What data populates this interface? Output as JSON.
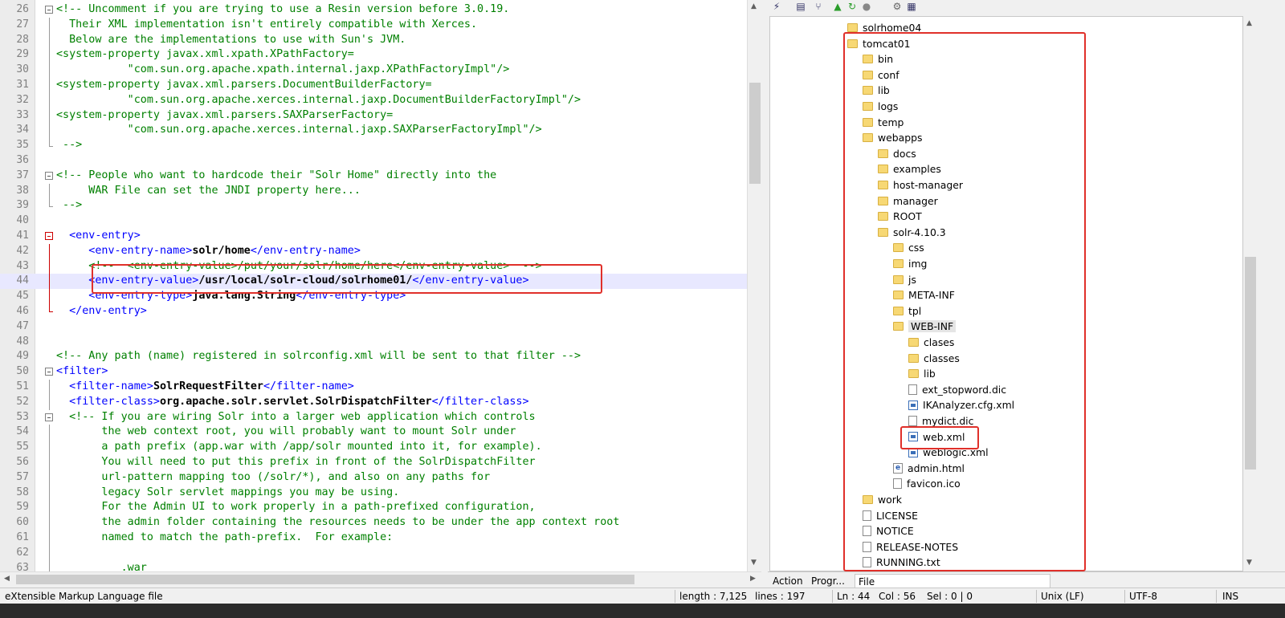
{
  "editor": {
    "lines": [
      {
        "n": "26",
        "fold": "box",
        "tok": [
          {
            "c": "com",
            "t": "<!-- Uncomment if you are trying to use a Resin version before 3.0.19."
          }
        ]
      },
      {
        "n": "27",
        "fold": "bar",
        "tok": [
          {
            "c": "com",
            "t": "  Their XML implementation isn't entirely compatible with Xerces."
          }
        ]
      },
      {
        "n": "28",
        "fold": "bar",
        "tok": [
          {
            "c": "com",
            "t": "  Below are the implementations to use with Sun's JVM."
          }
        ]
      },
      {
        "n": "29",
        "fold": "bar",
        "tok": [
          {
            "c": "com",
            "t": "<system-property javax.xml.xpath.XPathFactory="
          }
        ]
      },
      {
        "n": "30",
        "fold": "bar",
        "tok": [
          {
            "c": "com",
            "t": "           \"com.sun.org.apache.xpath.internal.jaxp.XPathFactoryImpl\"/>"
          }
        ]
      },
      {
        "n": "31",
        "fold": "bar",
        "tok": [
          {
            "c": "com",
            "t": "<system-property javax.xml.parsers.DocumentBuilderFactory="
          }
        ]
      },
      {
        "n": "32",
        "fold": "bar",
        "tok": [
          {
            "c": "com",
            "t": "           \"com.sun.org.apache.xerces.internal.jaxp.DocumentBuilderFactoryImpl\"/>"
          }
        ]
      },
      {
        "n": "33",
        "fold": "bar",
        "tok": [
          {
            "c": "com",
            "t": "<system-property javax.xml.parsers.SAXParserFactory="
          }
        ]
      },
      {
        "n": "34",
        "fold": "bar",
        "tok": [
          {
            "c": "com",
            "t": "           \"com.sun.org.apache.xerces.internal.jaxp.SAXParserFactoryImpl\"/>"
          }
        ]
      },
      {
        "n": "35",
        "fold": "end",
        "tok": [
          {
            "c": "com",
            "t": " -->"
          }
        ]
      },
      {
        "n": "36",
        "fold": "",
        "tok": []
      },
      {
        "n": "37",
        "fold": "box",
        "tok": [
          {
            "c": "com",
            "t": "<!-- People who want to hardcode their \"Solr Home\" directly into the"
          }
        ]
      },
      {
        "n": "38",
        "fold": "bar",
        "tok": [
          {
            "c": "com",
            "t": "     WAR File can set the JNDI property here..."
          }
        ]
      },
      {
        "n": "39",
        "fold": "end",
        "tok": [
          {
            "c": "com",
            "t": " -->"
          }
        ]
      },
      {
        "n": "40",
        "fold": "",
        "tok": []
      },
      {
        "n": "41",
        "fold": "redbox",
        "tok": [
          {
            "c": "tag",
            "t": "  <env-entry>"
          }
        ]
      },
      {
        "n": "42",
        "fold": "redbar",
        "tok": [
          {
            "c": "tag",
            "t": "     <env-entry-name>"
          },
          {
            "c": "txt",
            "t": "solr/home"
          },
          {
            "c": "tag",
            "t": "</env-entry-name>"
          }
        ]
      },
      {
        "n": "43",
        "fold": "redbar",
        "tok": [
          {
            "c": "com",
            "t": "     <!--  <env-entry-value>/put/your/solr/home/here</env-entry-value>  -->"
          }
        ]
      },
      {
        "n": "44",
        "fold": "redbar",
        "cur": true,
        "tok": [
          {
            "c": "tag",
            "t": "     <env-entry-value>"
          },
          {
            "c": "txt",
            "t": "/usr/local/solr-cloud/solrhome01/"
          },
          {
            "c": "tag",
            "t": "</env-entry-value>"
          }
        ]
      },
      {
        "n": "45",
        "fold": "redbar",
        "tok": [
          {
            "c": "tag",
            "t": "     <env-entry-type>"
          },
          {
            "c": "txt",
            "t": "java.lang.String"
          },
          {
            "c": "tag",
            "t": "</env-entry-type>"
          }
        ]
      },
      {
        "n": "46",
        "fold": "redend",
        "tok": [
          {
            "c": "tag",
            "t": "  </env-entry>"
          }
        ]
      },
      {
        "n": "47",
        "fold": "",
        "tok": []
      },
      {
        "n": "48",
        "fold": "",
        "tok": []
      },
      {
        "n": "49",
        "fold": "",
        "tok": [
          {
            "c": "com",
            "t": "<!-- Any path (name) registered in solrconfig.xml will be sent to that filter -->"
          }
        ]
      },
      {
        "n": "50",
        "fold": "box",
        "tok": [
          {
            "c": "tag",
            "t": "<filter>"
          }
        ]
      },
      {
        "n": "51",
        "fold": "bar",
        "tok": [
          {
            "c": "tag",
            "t": "  <filter-name>"
          },
          {
            "c": "txt",
            "t": "SolrRequestFilter"
          },
          {
            "c": "tag",
            "t": "</filter-name>"
          }
        ]
      },
      {
        "n": "52",
        "fold": "bar",
        "tok": [
          {
            "c": "tag",
            "t": "  <filter-class>"
          },
          {
            "c": "txt",
            "t": "org.apache.solr.servlet.SolrDispatchFilter"
          },
          {
            "c": "tag",
            "t": "</filter-class>"
          }
        ]
      },
      {
        "n": "53",
        "fold": "box",
        "tok": [
          {
            "c": "com",
            "t": "  <!-- If you are wiring Solr into a larger web application which controls"
          }
        ]
      },
      {
        "n": "54",
        "fold": "bar",
        "tok": [
          {
            "c": "com",
            "t": "       the web context root, you will probably want to mount Solr under"
          }
        ]
      },
      {
        "n": "55",
        "fold": "bar",
        "tok": [
          {
            "c": "com",
            "t": "       a path prefix (app.war with /app/solr mounted into it, for example)."
          }
        ]
      },
      {
        "n": "56",
        "fold": "bar",
        "tok": [
          {
            "c": "com",
            "t": "       You will need to put this prefix in front of the SolrDispatchFilter"
          }
        ]
      },
      {
        "n": "57",
        "fold": "bar",
        "tok": [
          {
            "c": "com",
            "t": "       url-pattern mapping too (/solr/*), and also on any paths for"
          }
        ]
      },
      {
        "n": "58",
        "fold": "bar",
        "tok": [
          {
            "c": "com",
            "t": "       legacy Solr servlet mappings you may be using."
          }
        ]
      },
      {
        "n": "59",
        "fold": "bar",
        "tok": [
          {
            "c": "com",
            "t": "       For the Admin UI to work properly in a path-prefixed configuration,"
          }
        ]
      },
      {
        "n": "60",
        "fold": "bar",
        "tok": [
          {
            "c": "com",
            "t": "       the admin folder containing the resources needs to be under the app context root"
          }
        ]
      },
      {
        "n": "61",
        "fold": "bar",
        "tok": [
          {
            "c": "com",
            "t": "       named to match the path-prefix.  For example:"
          }
        ]
      },
      {
        "n": "62",
        "fold": "bar",
        "tok": []
      },
      {
        "n": "63",
        "fold": "bar",
        "tok": [
          {
            "c": "com",
            "t": "          .war"
          }
        ]
      }
    ]
  },
  "tree": {
    "items": [
      {
        "label": "solrhome04",
        "type": "folder",
        "depth": 0
      },
      {
        "label": "tomcat01",
        "type": "folder",
        "depth": 0
      },
      {
        "label": "bin",
        "type": "folder",
        "depth": 1
      },
      {
        "label": "conf",
        "type": "folder",
        "depth": 1
      },
      {
        "label": "lib",
        "type": "folder",
        "depth": 1
      },
      {
        "label": "logs",
        "type": "folder",
        "depth": 1
      },
      {
        "label": "temp",
        "type": "folder",
        "depth": 1
      },
      {
        "label": "webapps",
        "type": "folder",
        "depth": 1
      },
      {
        "label": "docs",
        "type": "folder",
        "depth": 2
      },
      {
        "label": "examples",
        "type": "folder",
        "depth": 2
      },
      {
        "label": "host-manager",
        "type": "folder",
        "depth": 2
      },
      {
        "label": "manager",
        "type": "folder",
        "depth": 2
      },
      {
        "label": "ROOT",
        "type": "folder",
        "depth": 2
      },
      {
        "label": "solr-4.10.3",
        "type": "folder",
        "depth": 2
      },
      {
        "label": "css",
        "type": "folder",
        "depth": 3
      },
      {
        "label": "img",
        "type": "folder",
        "depth": 3
      },
      {
        "label": "js",
        "type": "folder",
        "depth": 3
      },
      {
        "label": "META-INF",
        "type": "folder",
        "depth": 3
      },
      {
        "label": "tpl",
        "type": "folder",
        "depth": 3
      },
      {
        "label": "WEB-INF",
        "type": "folder",
        "depth": 3,
        "selected": true
      },
      {
        "label": "clases",
        "type": "folder",
        "depth": 4
      },
      {
        "label": "classes",
        "type": "folder",
        "depth": 4
      },
      {
        "label": "lib",
        "type": "folder",
        "depth": 4
      },
      {
        "label": "ext_stopword.dic",
        "type": "file",
        "depth": 4
      },
      {
        "label": "IKAnalyzer.cfg.xml",
        "type": "xml",
        "depth": 4
      },
      {
        "label": "mydict.dic",
        "type": "file",
        "depth": 4
      },
      {
        "label": "web.xml",
        "type": "xml",
        "depth": 4
      },
      {
        "label": "weblogic.xml",
        "type": "xml",
        "depth": 4
      },
      {
        "label": "admin.html",
        "type": "html",
        "depth": 3
      },
      {
        "label": "favicon.ico",
        "type": "file",
        "depth": 3
      },
      {
        "label": "work",
        "type": "folder",
        "depth": 1
      },
      {
        "label": "LICENSE",
        "type": "file",
        "depth": 1
      },
      {
        "label": "NOTICE",
        "type": "file",
        "depth": 1
      },
      {
        "label": "RELEASE-NOTES",
        "type": "file",
        "depth": 1
      },
      {
        "label": "RUNNING.txt",
        "type": "file",
        "depth": 1
      }
    ]
  },
  "panel_tabs": [
    "Action",
    "Progr...",
    "File"
  ],
  "status": {
    "filetype": "eXtensible Markup Language file",
    "length": "length : 7,125",
    "lines": "lines : 197",
    "ln": "Ln : 44",
    "col": "Col : 56",
    "sel": "Sel : 0 | 0",
    "eol": "Unix (LF)",
    "encoding": "UTF-8",
    "ins": "INS"
  },
  "colors": {
    "comment": "#008000",
    "tag": "#0000ff",
    "highlight": "#e0302a",
    "current_line": "#e8e8ff"
  },
  "icons": [
    "connect-icon",
    "file-icon",
    "path-icon",
    "up-icon",
    "refresh-icon",
    "stop-icon",
    "settings-icon",
    "view-icon"
  ]
}
